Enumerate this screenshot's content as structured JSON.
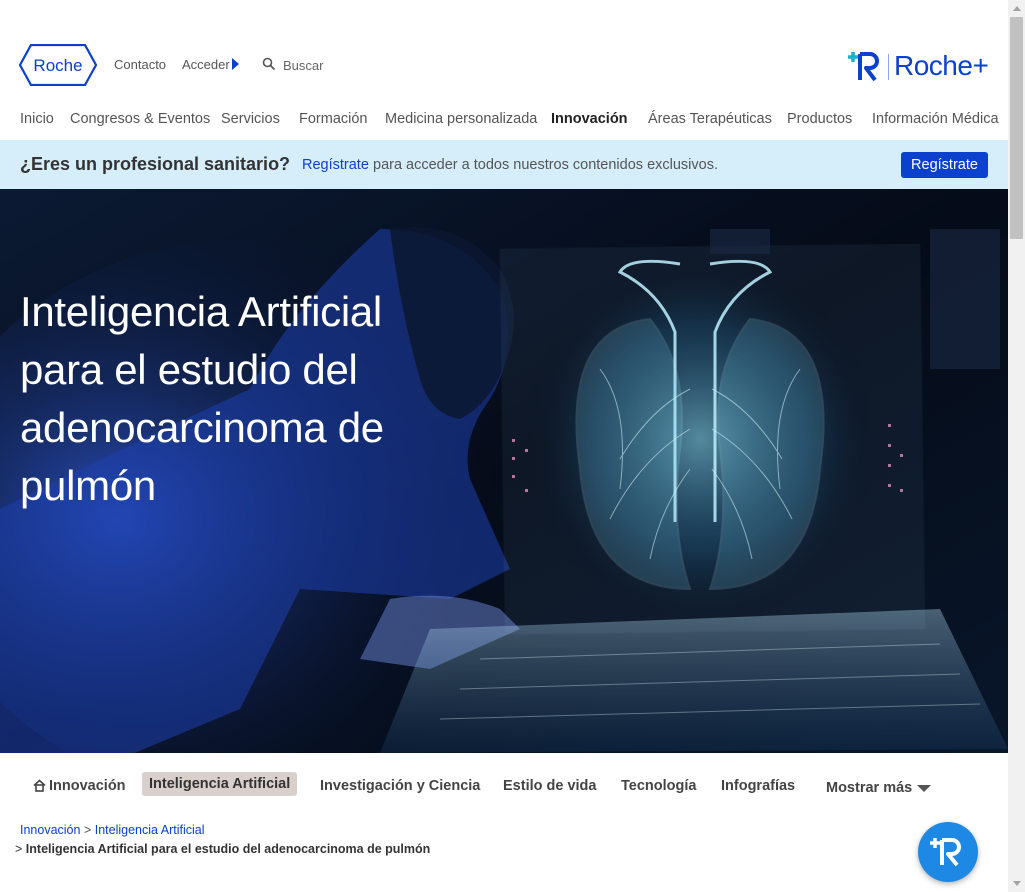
{
  "header": {
    "logo_text": "Roche",
    "contacto": "Contacto",
    "acceder": "Acceder",
    "search_placeholder": "Buscar",
    "brand_plus": "Roche+"
  },
  "nav": {
    "items": [
      {
        "label": "Inicio"
      },
      {
        "label": "Congresos & Eventos"
      },
      {
        "label": "Servicios"
      },
      {
        "label": "Formación"
      },
      {
        "label": "Medicina personalizada"
      },
      {
        "label": "Innovación",
        "active": true
      },
      {
        "label": "Áreas Terapéuticas"
      },
      {
        "label": "Productos"
      },
      {
        "label": "Información Médica"
      }
    ]
  },
  "banner": {
    "question": "¿Eres un profesional sanitario?",
    "link": "Regístrate",
    "text": "para acceder a todos nuestros contenidos exclusivos.",
    "button": "Regístrate"
  },
  "hero": {
    "title": "Inteligencia Artificial para el estudio del adenocarcinoma de pulmón"
  },
  "subnav": {
    "items": [
      {
        "label": "Innovación"
      },
      {
        "label": "Inteligencia Artificial",
        "active": true
      },
      {
        "label": "Investigación y Ciencia"
      },
      {
        "label": "Estilo de vida"
      },
      {
        "label": "Tecnología"
      },
      {
        "label": "Infografías"
      },
      {
        "label": "Mostrar más"
      }
    ]
  },
  "breadcrumb": {
    "level1": "Innovación",
    "sep": ">",
    "level2": "Inteligencia Artificial",
    "current": "Inteligencia Artificial para el estudio del adenocarcinoma de pulmón"
  },
  "colors": {
    "brand_blue": "#0b41cd",
    "banner_bg": "#d6eefa",
    "fab_blue": "#1e88e5"
  },
  "icons": {
    "search": "search-icon",
    "home": "home-icon",
    "fab": "roche-plus-chat-icon"
  }
}
